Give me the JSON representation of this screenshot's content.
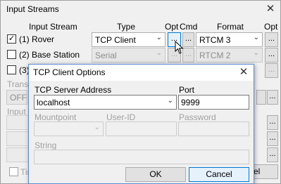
{
  "main": {
    "title": "Input Streams",
    "close_glyph": "✕",
    "headers": {
      "stream": "Input Stream",
      "type": "Type",
      "opt": "Opt",
      "cmd": "Cmd",
      "format": "Format",
      "opt2": "Opt"
    },
    "rows": [
      {
        "checked": true,
        "label": "(1) Rover",
        "type": "TCP Client",
        "format": "RTCM 3",
        "opt_btn": "...",
        "cmd_btn": "...",
        "fmt_opt_btn": "..."
      },
      {
        "checked": false,
        "label": "(2) Base Station",
        "type": "Serial",
        "format": "RTCM 2",
        "opt_btn": "...",
        "cmd_btn": "...",
        "fmt_opt_btn": "..."
      },
      {
        "checked": false,
        "label": "(3)",
        "opt_btn": "...",
        "fmt_opt_btn": "..."
      }
    ],
    "transmit_label": "Transm",
    "transmit_value": "OFF",
    "input_label": "Input",
    "time_label": "Tim",
    "cancel_partial": "el",
    "side_btn": "..."
  },
  "dialog": {
    "title": "TCP Client Options",
    "close_glyph": "✕",
    "server_address_label": "TCP Server Address",
    "server_address_value": "localhost",
    "port_label": "Port",
    "port_value": "9999",
    "mountpoint_label": "Mountpoint",
    "userid_label": "User-ID",
    "password_label": "Password",
    "string_label": "String",
    "ok_label": "OK",
    "cancel_label": "Cancel"
  }
}
